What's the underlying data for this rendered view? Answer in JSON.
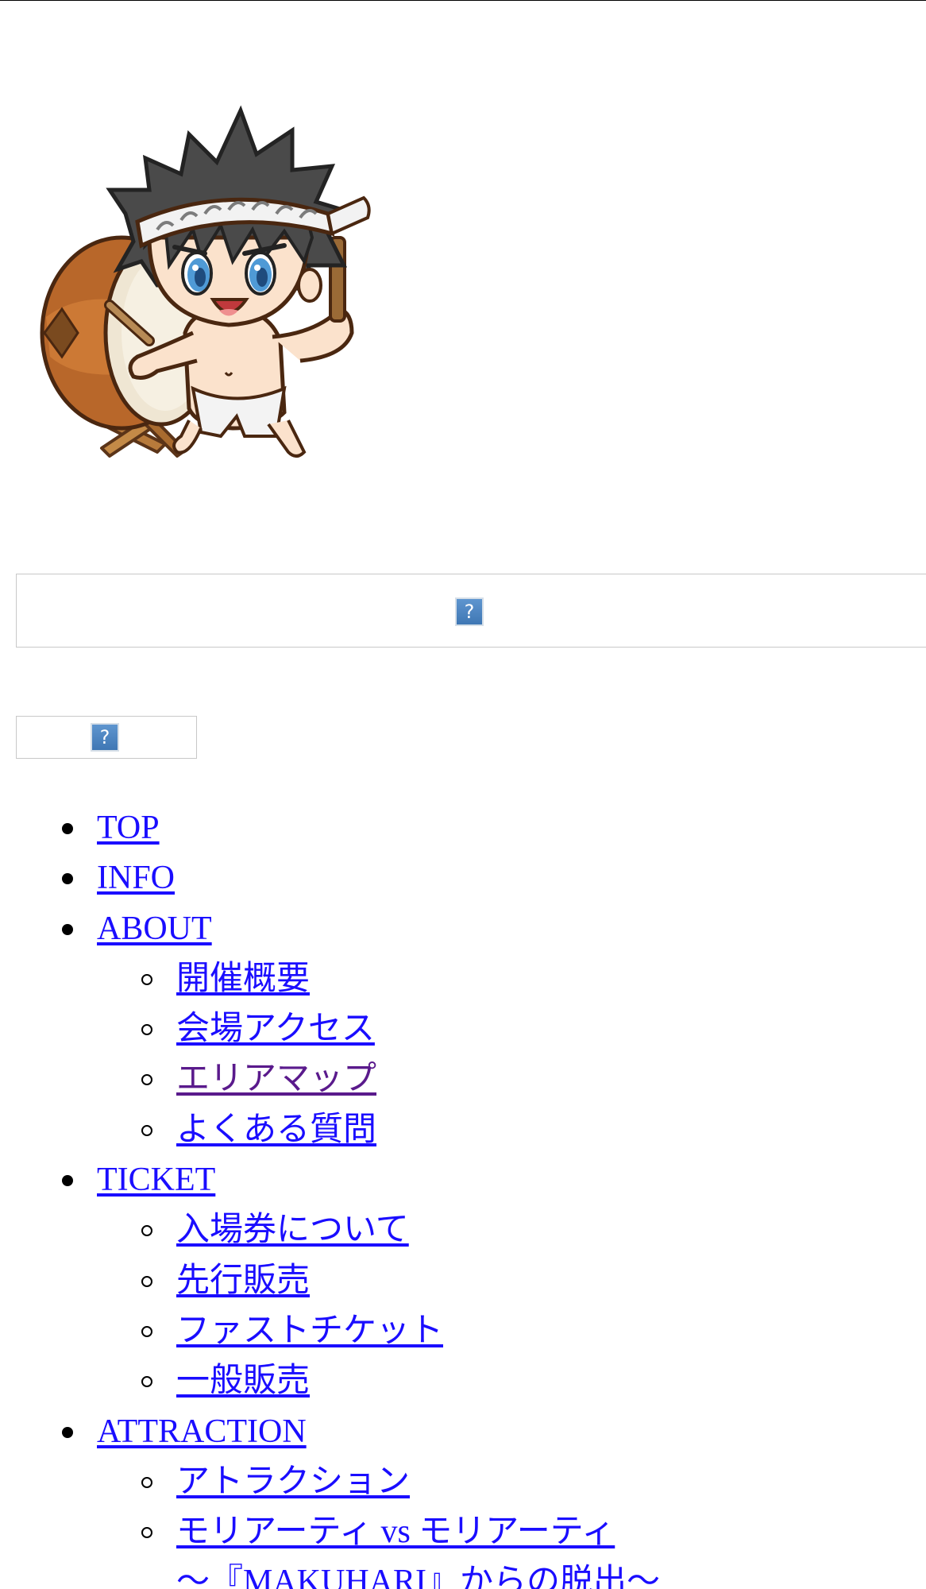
{
  "header": {
    "mascot_name": "mascot-drummer"
  },
  "banner": {
    "icon": "broken-image-icon",
    "glyph": "?"
  },
  "logo_box": {
    "icon": "broken-image-icon",
    "glyph": "?"
  },
  "nav": {
    "top": " TOP",
    "info": " INFO",
    "about": " ABOUT",
    "about_items": [
      "開催概要",
      "会場アクセス",
      "エリアマップ",
      "よくある質問"
    ],
    "ticket": " TICKET",
    "ticket_items": [
      "入場券について",
      "先行販売",
      "ファストチケット",
      "一般販売"
    ],
    "attraction": " ATTRACTION",
    "attraction_items": [
      "アトラクション",
      "モリアーティ vs モリアーティ ",
      "～『MAKUHARI』からの脱出～"
    ]
  },
  "colors": {
    "link": "#1a0dff",
    "visited_link": "#5a1a8c"
  }
}
